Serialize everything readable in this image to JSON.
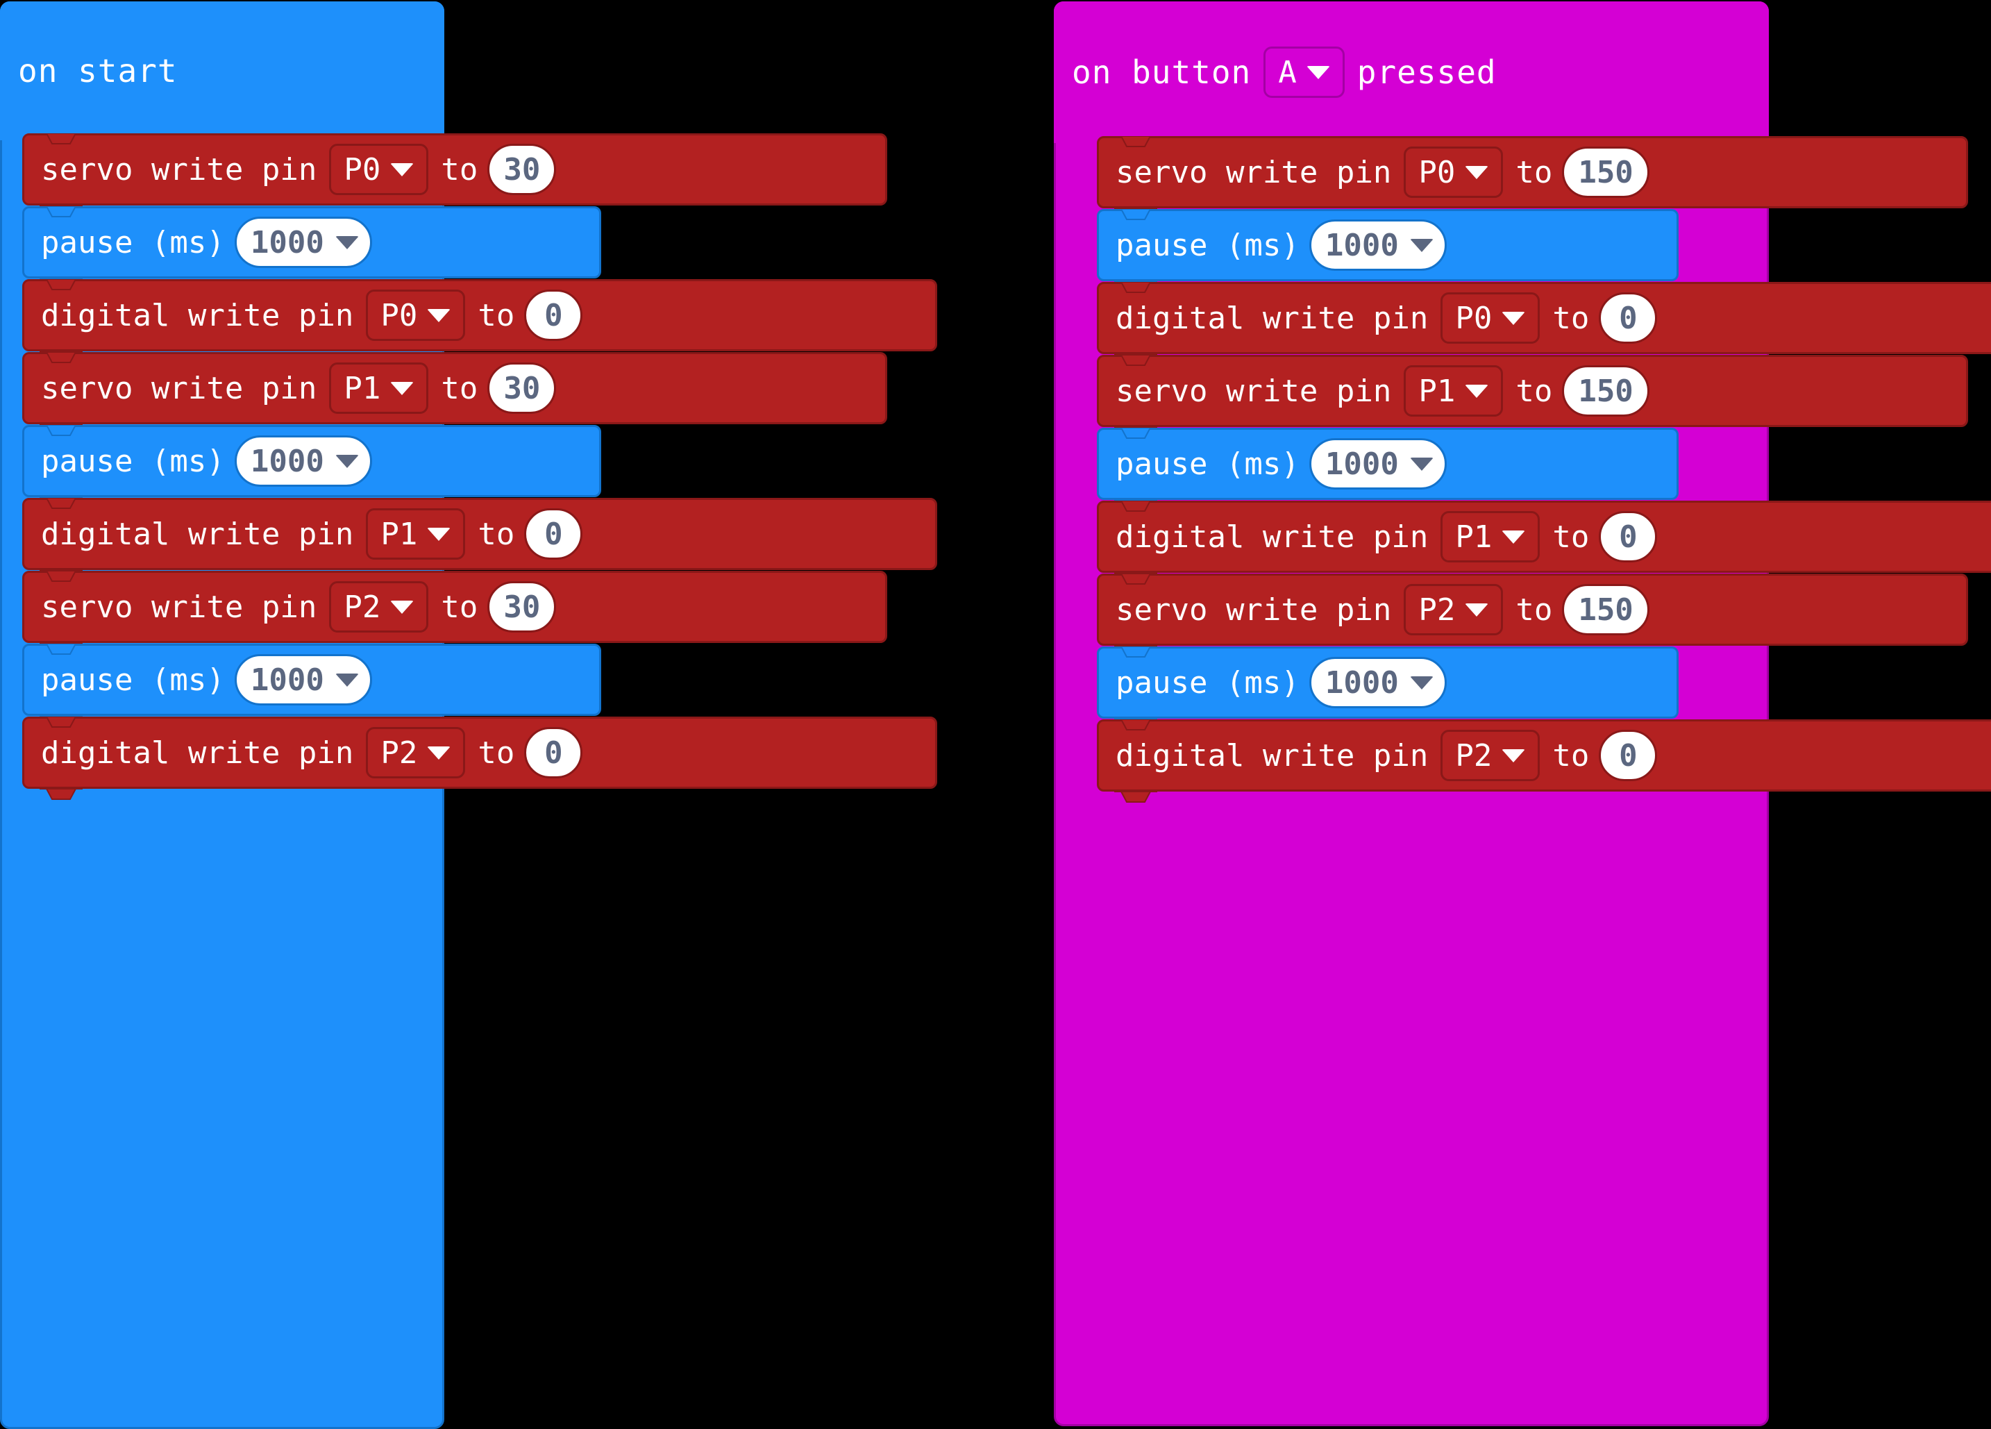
{
  "colors": {
    "background": "#000000",
    "event_blue": "#1E90FB",
    "event_magenta": "#D400D4",
    "pins_red": "#B32121",
    "basic_blue": "#1E90FB",
    "field_text": "#5b6780",
    "block_text": "#ffffff"
  },
  "workspace": {
    "stacks": [
      {
        "id": "stack-on-start",
        "event": {
          "name": "on-start",
          "color": "#1E90FB",
          "label_parts": [
            "on start"
          ],
          "text": "on start"
        },
        "statements": [
          {
            "kind": "servo-write-pin",
            "color": "red",
            "label": "servo write pin",
            "pin": "P0",
            "to_label": "to",
            "value": "30"
          },
          {
            "kind": "pause-ms",
            "color": "blue",
            "label": "pause (ms)",
            "value": "1000"
          },
          {
            "kind": "digital-write-pin",
            "color": "red",
            "label": "digital write pin",
            "pin": "P0",
            "to_label": "to",
            "value": "0"
          },
          {
            "kind": "servo-write-pin",
            "color": "red",
            "label": "servo write pin",
            "pin": "P1",
            "to_label": "to",
            "value": "30"
          },
          {
            "kind": "pause-ms",
            "color": "blue",
            "label": "pause (ms)",
            "value": "1000"
          },
          {
            "kind": "digital-write-pin",
            "color": "red",
            "label": "digital write pin",
            "pin": "P1",
            "to_label": "to",
            "value": "0"
          },
          {
            "kind": "servo-write-pin",
            "color": "red",
            "label": "servo write pin",
            "pin": "P2",
            "to_label": "to",
            "value": "30"
          },
          {
            "kind": "pause-ms",
            "color": "blue",
            "label": "pause (ms)",
            "value": "1000"
          },
          {
            "kind": "digital-write-pin",
            "color": "red",
            "label": "digital write pin",
            "pin": "P2",
            "to_label": "to",
            "value": "0"
          }
        ]
      },
      {
        "id": "stack-on-button-pressed",
        "event": {
          "name": "on-button-pressed",
          "color": "#D400D4",
          "label_prefix": "on button",
          "button": "A",
          "label_suffix": "pressed",
          "text": "on button A pressed"
        },
        "statements": [
          {
            "kind": "servo-write-pin",
            "color": "red",
            "label": "servo write pin",
            "pin": "P0",
            "to_label": "to",
            "value": "150"
          },
          {
            "kind": "pause-ms",
            "color": "blue",
            "label": "pause (ms)",
            "value": "1000"
          },
          {
            "kind": "digital-write-pin",
            "color": "red",
            "label": "digital write pin",
            "pin": "P0",
            "to_label": "to",
            "value": "0"
          },
          {
            "kind": "servo-write-pin",
            "color": "red",
            "label": "servo write pin",
            "pin": "P1",
            "to_label": "to",
            "value": "150"
          },
          {
            "kind": "pause-ms",
            "color": "blue",
            "label": "pause (ms)",
            "value": "1000"
          },
          {
            "kind": "digital-write-pin",
            "color": "red",
            "label": "digital write pin",
            "pin": "P1",
            "to_label": "to",
            "value": "0"
          },
          {
            "kind": "servo-write-pin",
            "color": "red",
            "label": "servo write pin",
            "pin": "P2",
            "to_label": "to",
            "value": "150"
          },
          {
            "kind": "pause-ms",
            "color": "blue",
            "label": "pause (ms)",
            "value": "1000"
          },
          {
            "kind": "digital-write-pin",
            "color": "red",
            "label": "digital write pin",
            "pin": "P2",
            "to_label": "to",
            "value": "0"
          }
        ]
      }
    ]
  },
  "icons": {
    "dropdown_caret": "chevron-down-icon"
  }
}
